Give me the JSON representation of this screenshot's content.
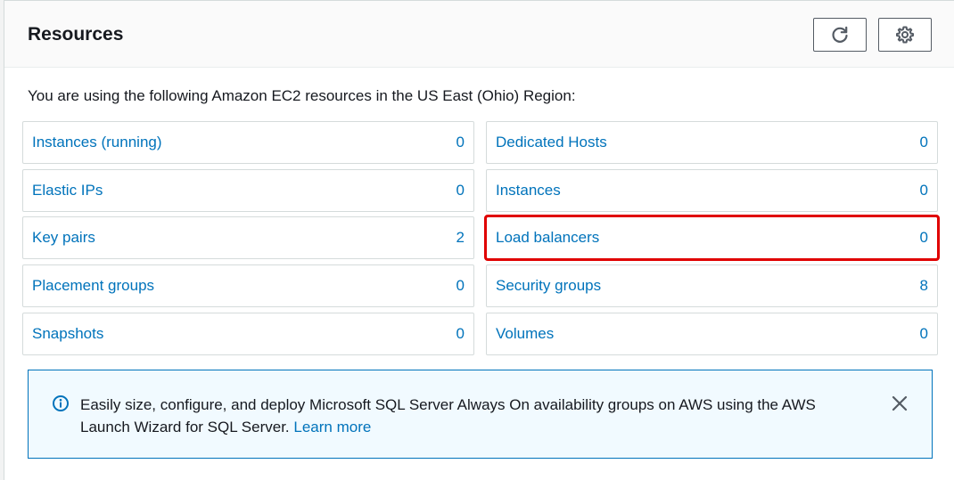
{
  "panel": {
    "title": "Resources",
    "intro": "You are using the following Amazon EC2 resources in the US East (Ohio) Region:"
  },
  "header_icons": [
    "refresh-icon",
    "gear-icon"
  ],
  "resources": {
    "left": [
      {
        "label": "Instances (running)",
        "count": "0"
      },
      {
        "label": "Elastic IPs",
        "count": "0"
      },
      {
        "label": "Key pairs",
        "count": "2"
      },
      {
        "label": "Placement groups",
        "count": "0"
      },
      {
        "label": "Snapshots",
        "count": "0"
      }
    ],
    "right": [
      {
        "label": "Dedicated Hosts",
        "count": "0"
      },
      {
        "label": "Instances",
        "count": "0"
      },
      {
        "label": "Load balancers",
        "count": "0"
      },
      {
        "label": "Security groups",
        "count": "8"
      },
      {
        "label": "Volumes",
        "count": "0"
      }
    ]
  },
  "alert": {
    "text": "Easily size, configure, and deploy Microsoft SQL Server Always On availability groups on AWS using the AWS Launch Wizard for SQL Server.",
    "link": "Learn more",
    "icon": "info-icon",
    "close_icon": "close-icon"
  },
  "colors": {
    "link": "#0073bb",
    "highlight": "#e00000",
    "alert_bg": "#f1faff"
  }
}
